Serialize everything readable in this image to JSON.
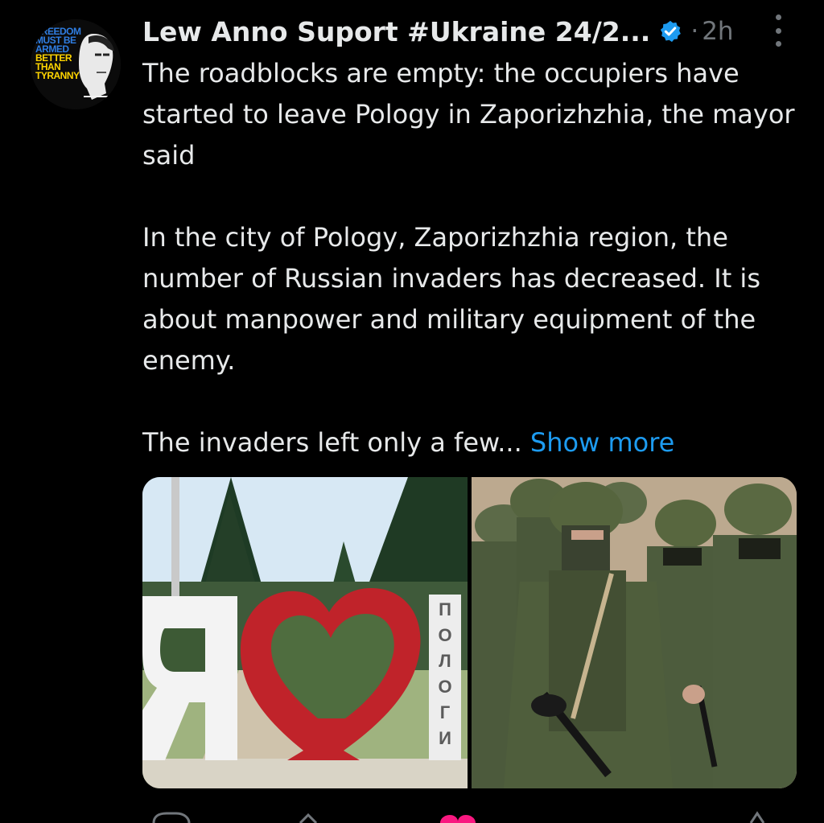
{
  "author": {
    "name": "Lew Anno Suport #Ukraine 24/2...",
    "verified": true,
    "avatar_text": [
      "FREEDOM",
      "MUST BE",
      "ARMED",
      "BETTER",
      "THAN",
      "TYRANNY"
    ]
  },
  "post": {
    "time_separator": "·",
    "timestamp": "2h",
    "paragraph_1": "The roadblocks are empty: the occupiers have started to leave Pology in Zaporizhzhia, the mayor said",
    "paragraph_2": "In the city of Pology, Zaporizhzhia region, the number of Russian invaders has decreased. It is about manpower and military equipment of the enemy.",
    "paragraph_3": "The invaders left only a few...",
    "show_more_label": "Show more",
    "sign_letters": [
      "П",
      "О",
      "Л",
      "О",
      "Г",
      "И"
    ]
  },
  "media": [
    {
      "name": "photo-pology-heart-sign"
    },
    {
      "name": "photo-soldiers"
    }
  ],
  "colors": {
    "background": "#000000",
    "text": "#e7e9ea",
    "muted": "#71767b",
    "link": "#1d9bf0",
    "verified": "#1d9bf0"
  },
  "icons": [
    "verified-badge-icon",
    "more-options-icon",
    "reply-icon",
    "repost-icon",
    "like-icon",
    "share-icon"
  ]
}
